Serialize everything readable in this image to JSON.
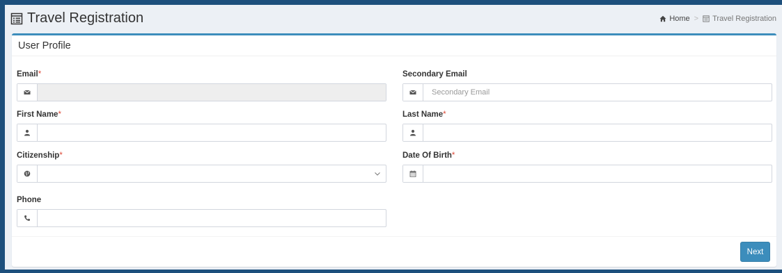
{
  "header": {
    "title": "Travel Registration",
    "breadcrumb": {
      "home": "Home",
      "current": "Travel Registration"
    }
  },
  "box": {
    "title": "User Profile",
    "fields": {
      "email": {
        "label": "Email",
        "required": "*",
        "value": "",
        "icon": "envelope-icon"
      },
      "secondary_email": {
        "label": "Secondary Email",
        "placeholder": "Secondary Email",
        "icon": "envelope-icon"
      },
      "first_name": {
        "label": "First Name",
        "required": "*",
        "value": "",
        "icon": "user-icon"
      },
      "last_name": {
        "label": "Last Name",
        "required": "*",
        "value": "",
        "icon": "user-icon"
      },
      "citizenship": {
        "label": "Citizenship",
        "required": "*",
        "value": "",
        "icon": "globe-icon"
      },
      "dob": {
        "label": "Date Of Birth",
        "required": "*",
        "value": "",
        "icon": "calendar-icon"
      },
      "phone": {
        "label": "Phone",
        "value": "",
        "icon": "phone-icon"
      }
    },
    "next_label": "Next"
  },
  "colors": {
    "accent": "#3c8dbc",
    "frame": "#1d4f7c",
    "required": "#dd4b39"
  }
}
